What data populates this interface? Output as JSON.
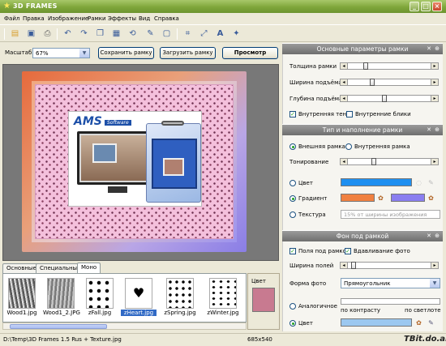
{
  "window": {
    "title": "3D FRAMES"
  },
  "menu": [
    "Файл",
    "Правка",
    "Изображение",
    "Рамки",
    "Эффекты",
    "Вид",
    "Справка"
  ],
  "zoom": {
    "label": "Масштаб",
    "value": "67%",
    "save_frame": "Сохранить рамку",
    "load_frame": "Загрузить рамку",
    "preview": "Просмотр"
  },
  "canvas": {
    "brand": "AMS",
    "brand_sub": "Software"
  },
  "thumb_tabs": [
    "Основные",
    "Специальные",
    "Моно"
  ],
  "thumbnails": [
    "Wood1.jpg",
    "Wood1_2.JPG",
    "zFall.jpg",
    "zHeart.jpg",
    "zSpring.jpg",
    "zWinter.jpg"
  ],
  "color_panel": {
    "label": "Цвет",
    "color": "#c87a90"
  },
  "status": {
    "path": "D:\\Temp\\3D Frames 1.5 Rus + Texture.jpg",
    "size": "685x540"
  },
  "section1": {
    "title": "Основные параметры рамки",
    "frame_width": "Толщина рамки",
    "lift_width": "Ширина подъёма",
    "lift_depth": "Глубина подъёма",
    "inner_shadow": "Внутренняя тень",
    "inner_glare": "Внутренние блики",
    "frame_width_level": 0.2,
    "lift_width_level": 0.28,
    "lift_depth_level": 0.44
  },
  "section2": {
    "title": "Тип и наполнение рамки",
    "outer": "Внешняя рамка",
    "inner": "Внутренняя рамка",
    "toning": "Тонирование",
    "color": "Цвет",
    "gradient": "Градиент",
    "texture": "Текстура",
    "texture_value": "15% от ширины изображения",
    "color_value": "#1e8ff0",
    "gradient_from": "#f08040",
    "gradient_to": "#8a7ef0",
    "toning_level": 0.3
  },
  "section3": {
    "title": "Фон под рамкой",
    "bg_under": "Поля под рамкой",
    "emboss": "Вдавливание фото",
    "margin_width": "Ширина полей",
    "photo_shape": "Форма фото",
    "shape_value": "Прямоугольник",
    "analog": "Аналогичное",
    "by_contrast": "по контрасту",
    "by_brightness": "по светлоте",
    "color": "Цвет",
    "color_value": "#9cc8f0",
    "margin_level": 0.04
  },
  "site": "TBit.do.am"
}
